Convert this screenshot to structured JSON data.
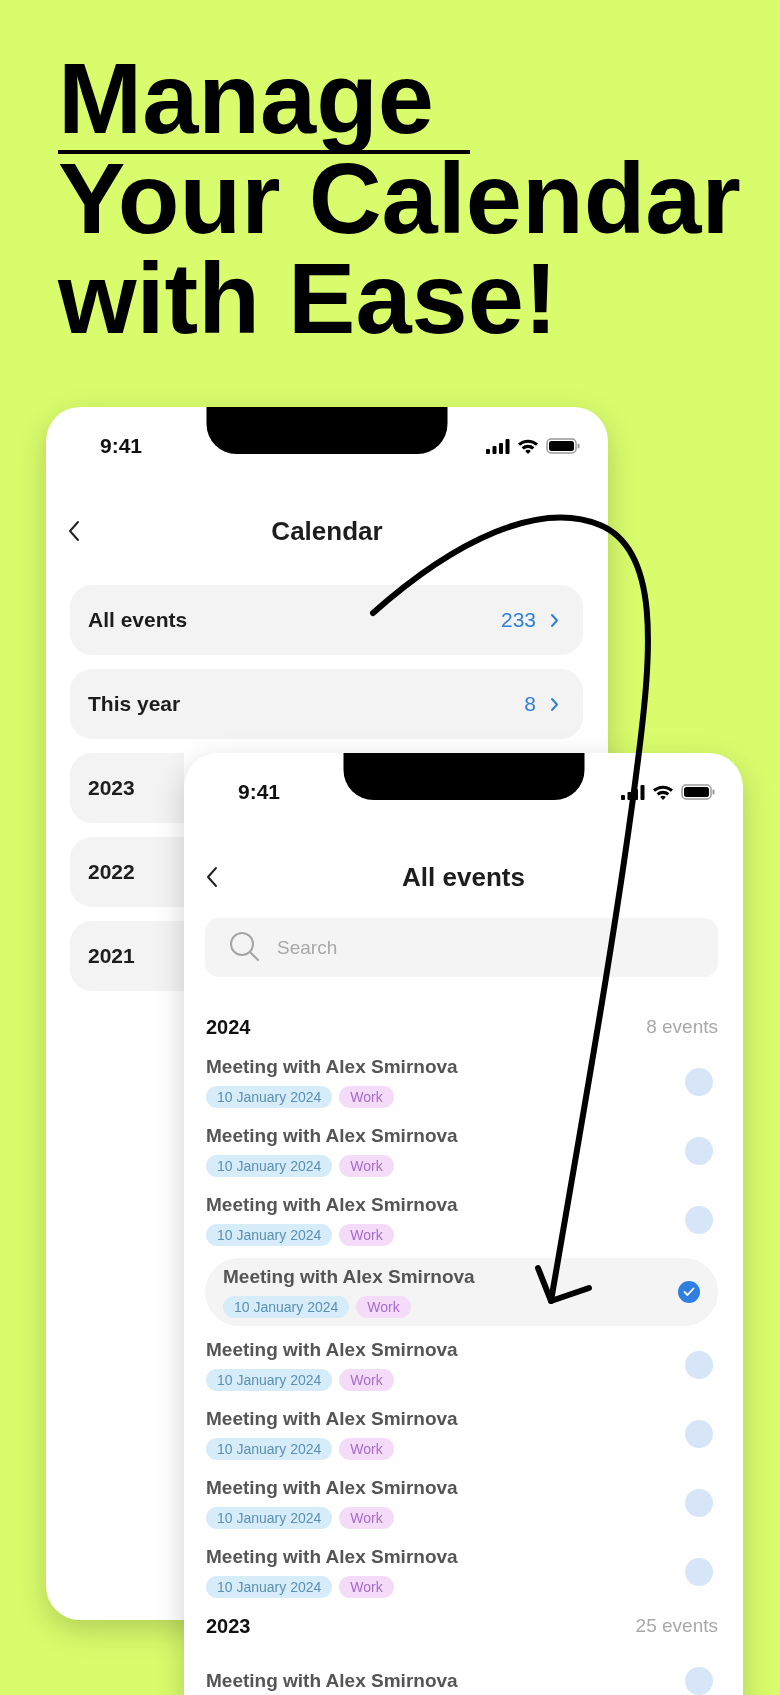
{
  "headline": {
    "lines": [
      {
        "text": "Manage",
        "underlined": true
      },
      {
        "text": "Your Calendar",
        "underlined": false
      },
      {
        "text": "with Ease!",
        "underlined": false
      }
    ]
  },
  "back_phone": {
    "time": "9:41",
    "title": "Calendar",
    "items": [
      {
        "label": "All events",
        "count": "233"
      },
      {
        "label": "This year",
        "count": "8"
      },
      {
        "label": "2023"
      },
      {
        "label": "2022"
      },
      {
        "label": "2021"
      }
    ]
  },
  "front_phone": {
    "time": "9:41",
    "title": "All events",
    "search": {
      "placeholder": "Search"
    },
    "groups": [
      {
        "year": "2024",
        "count": "8 events",
        "events": [
          {
            "title": "Meeting with Alex Smirnova",
            "date": "10 January 2024",
            "tag": "Work",
            "selected": false
          },
          {
            "title": "Meeting with Alex Smirnova",
            "date": "10 January 2024",
            "tag": "Work",
            "selected": false
          },
          {
            "title": "Meeting with Alex Smirnova",
            "date": "10 January 2024",
            "tag": "Work",
            "selected": false
          },
          {
            "title": "Meeting with Alex Smirnova",
            "date": "10 January 2024",
            "tag": "Work",
            "selected": true
          },
          {
            "title": "Meeting with Alex Smirnova",
            "date": "10 January 2024",
            "tag": "Work",
            "selected": false
          },
          {
            "title": "Meeting with Alex Smirnova",
            "date": "10 January 2024",
            "tag": "Work",
            "selected": false
          },
          {
            "title": "Meeting with Alex Smirnova",
            "date": "10 January 2024",
            "tag": "Work",
            "selected": false
          },
          {
            "title": "Meeting with Alex Smirnova",
            "date": "10 January 2024",
            "tag": "Work",
            "selected": false
          }
        ]
      },
      {
        "year": "2023",
        "count": "25 events",
        "events": [
          {
            "title": "Meeting with Alex Smirnova",
            "selected": false
          }
        ]
      }
    ]
  }
}
